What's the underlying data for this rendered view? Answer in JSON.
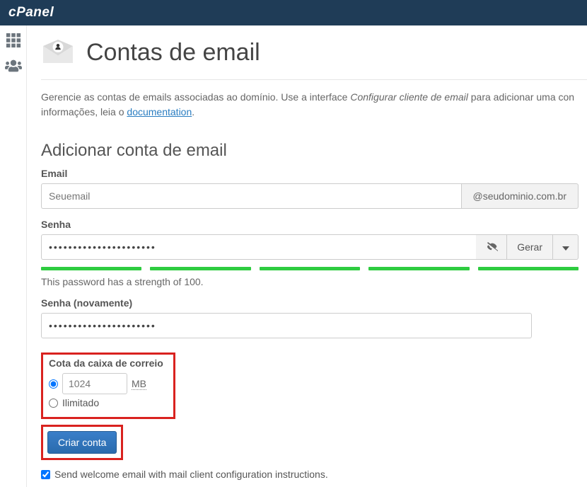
{
  "brand": "cPanel",
  "page": {
    "title": "Contas de email",
    "intro_a": "Gerencie as contas de emails associadas ao domínio. Use a interface ",
    "intro_em": "Configurar cliente de email",
    "intro_b": " para adicionar uma con informações, leia o ",
    "doc_link": "documentation",
    "intro_c": "."
  },
  "form": {
    "section_title": "Adicionar conta de email",
    "email_label": "Email",
    "email_value": "Seuemail",
    "domain": "@seudominio.com.br",
    "password_label": "Senha",
    "password_value": "••••••••••••••••••••••",
    "gerar_label": "Gerar",
    "strength_text": "This password has a strength of 100.",
    "password2_label": "Senha (novamente)",
    "password2_value": "••••••••••••••••••••••",
    "quota_label": "Cota da caixa de correio",
    "quota_value": "1024",
    "quota_unit": "MB",
    "unlimited_label": "Ilimitado",
    "submit_label": "Criar conta",
    "welcome_label": "Send welcome email with mail client configuration instructions."
  }
}
